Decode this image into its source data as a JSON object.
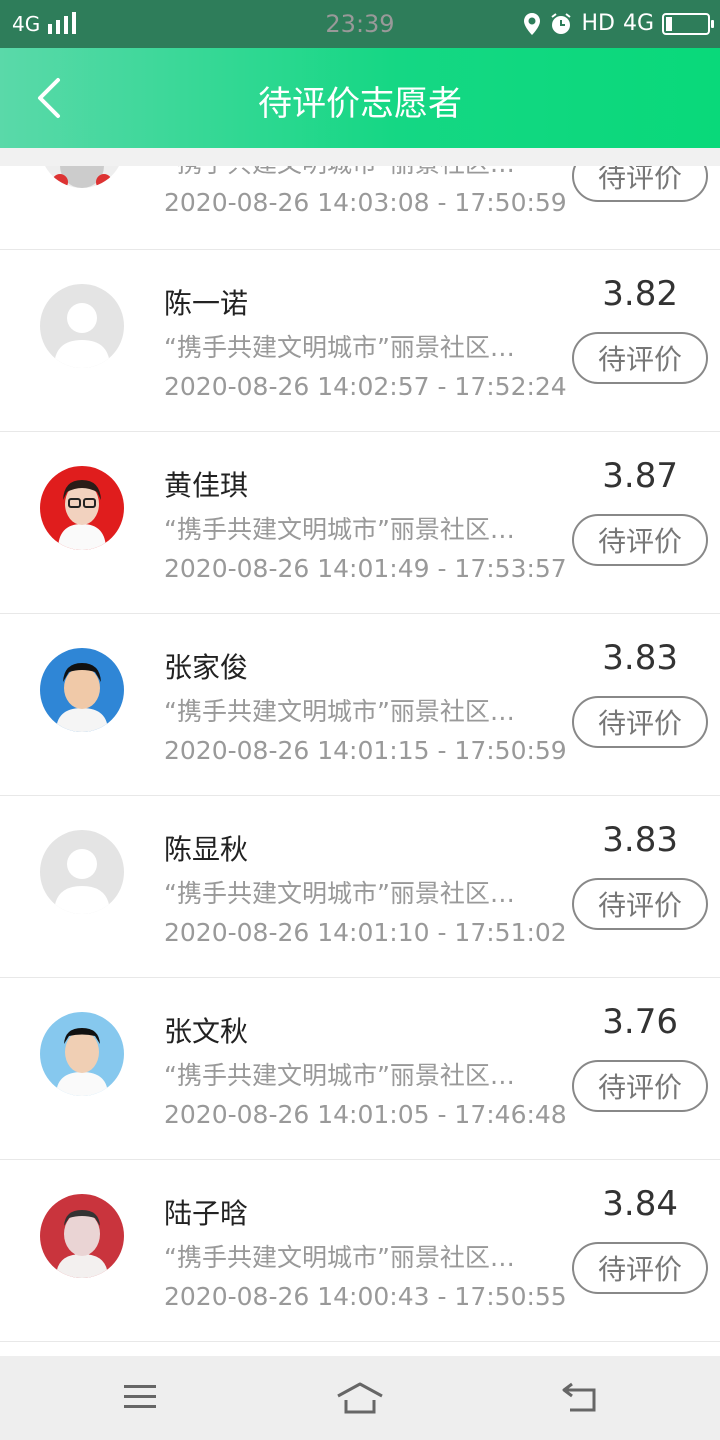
{
  "status": {
    "network": "4G",
    "time": "23:39",
    "hd": "HD",
    "net2": "4G"
  },
  "header": {
    "title": "待评价志愿者"
  },
  "list": [
    {
      "name": "",
      "activity": "“携手共建文明城市”丽景社区…",
      "time": "2020-08-26 14:03:08 - 17:50:59",
      "score": "",
      "action": "待评价",
      "avatar": "person-default"
    },
    {
      "name": "陈一诺",
      "activity": "“携手共建文明城市”丽景社区…",
      "time": "2020-08-26 14:02:57 - 17:52:24",
      "score": "3.82",
      "action": "待评价",
      "avatar": "placeholder"
    },
    {
      "name": "黄佳琪",
      "activity": "“携手共建文明城市”丽景社区…",
      "time": "2020-08-26 14:01:49 - 17:53:57",
      "score": "3.87",
      "action": "待评价",
      "avatar": "red"
    },
    {
      "name": "张家俊",
      "activity": "“携手共建文明城市”丽景社区…",
      "time": "2020-08-26 14:01:15 - 17:50:59",
      "score": "3.83",
      "action": "待评价",
      "avatar": "blue"
    },
    {
      "name": "陈显秋",
      "activity": "“携手共建文明城市”丽景社区…",
      "time": "2020-08-26 14:01:10 - 17:51:02",
      "score": "3.83",
      "action": "待评价",
      "avatar": "placeholder"
    },
    {
      "name": "张文秋",
      "activity": "“携手共建文明城市”丽景社区…",
      "time": "2020-08-26 14:01:05 - 17:46:48",
      "score": "3.76",
      "action": "待评价",
      "avatar": "lightblue"
    },
    {
      "name": "陆子晗",
      "activity": "“携手共建文明城市”丽景社区…",
      "time": "2020-08-26 14:00:43 - 17:50:55",
      "score": "3.84",
      "action": "待评价",
      "avatar": "redlight"
    }
  ],
  "icons": {
    "back": "back-arrow-icon",
    "menu": "menu-icon",
    "home": "home-icon",
    "return": "return-icon"
  },
  "colors": {
    "header_start": "#5ad9a9",
    "header_end": "#09d97a",
    "statusbar": "#2e7d5a"
  }
}
